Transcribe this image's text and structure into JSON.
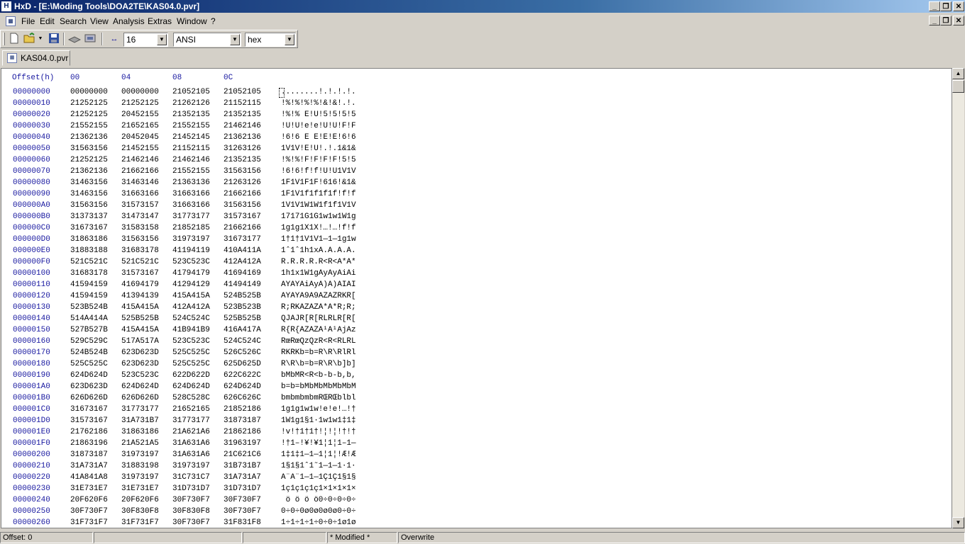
{
  "window": {
    "title": "HxD - [E:\\Moding Tools\\DOA2TE\\KAS04.0.pvr]"
  },
  "menu": [
    "File",
    "Edit",
    "Search",
    "View",
    "Analysis",
    "Extras",
    "Window",
    "?"
  ],
  "toolbar": {
    "bytes_per_row": "16",
    "charset": "ANSI",
    "offset_base": "hex"
  },
  "tabs": [
    {
      "label": "KAS04.0.pvr"
    }
  ],
  "hexview": {
    "header": {
      "offset": "Offset(h)",
      "cols": [
        "00",
        "04",
        "08",
        "0C"
      ]
    },
    "rows": [
      {
        "offset": "00000000",
        "hex": [
          "00000000",
          "00000000",
          "21052105",
          "21052105"
        ],
        "text": "........!.!.!.!."
      },
      {
        "offset": "00000010",
        "hex": [
          "21252125",
          "21252125",
          "21262126",
          "21152115"
        ],
        "text": "!%!%!%!%!&!&!.!."
      },
      {
        "offset": "00000020",
        "hex": [
          "21252125",
          "20452155",
          "21352135",
          "21352135"
        ],
        "text": "!%!% E!U!5!5!5!5"
      },
      {
        "offset": "00000030",
        "hex": [
          "21552155",
          "21652165",
          "21552155",
          "21462146"
        ],
        "text": "!U!U!e!e!U!U!F!F"
      },
      {
        "offset": "00000040",
        "hex": [
          "21362136",
          "20452045",
          "21452145",
          "21362136"
        ],
        "text": "!6!6 E E!E!E!6!6"
      },
      {
        "offset": "00000050",
        "hex": [
          "31563156",
          "21452155",
          "21152115",
          "31263126"
        ],
        "text": "1V1V!E!U!.!.1&1&"
      },
      {
        "offset": "00000060",
        "hex": [
          "21252125",
          "21462146",
          "21462146",
          "21352135"
        ],
        "text": "!%!%!F!F!F!F!5!5"
      },
      {
        "offset": "00000070",
        "hex": [
          "21362136",
          "21662166",
          "21552155",
          "31563156"
        ],
        "text": "!6!6!f!f!U!U1V1V"
      },
      {
        "offset": "00000080",
        "hex": [
          "31463156",
          "31463146",
          "21363136",
          "21263126"
        ],
        "text": "1F1V1F1F!616!&1&"
      },
      {
        "offset": "00000090",
        "hex": [
          "31463156",
          "31663166",
          "31663166",
          "21662166"
        ],
        "text": "1F1V1f1f1f1f!f!f"
      },
      {
        "offset": "000000A0",
        "hex": [
          "31563156",
          "31573157",
          "31663166",
          "31563156"
        ],
        "text": "1V1V1W1W1f1f1V1V"
      },
      {
        "offset": "000000B0",
        "hex": [
          "31373137",
          "31473147",
          "31773177",
          "31573167"
        ],
        "text": "17171G1G1w1w1W1g"
      },
      {
        "offset": "000000C0",
        "hex": [
          "31673167",
          "31583158",
          "21852185",
          "21662166"
        ],
        "text": "1g1g1X1X!…!…!f!f"
      },
      {
        "offset": "000000D0",
        "hex": [
          "31863186",
          "31563156",
          "31973197",
          "31673177"
        ],
        "text": "1†1†1V1V1—1—1g1w"
      },
      {
        "offset": "000000E0",
        "hex": [
          "31883188",
          "31683178",
          "41194119",
          "410A411A"
        ],
        "text": "1ˆ1ˆ1h1xA.A.A.A."
      },
      {
        "offset": "000000F0",
        "hex": [
          "521C521C",
          "521C521C",
          "523C523C",
          "412A412A"
        ],
        "text": "R.R.R.R.R<R<A*A*"
      },
      {
        "offset": "00000100",
        "hex": [
          "31683178",
          "31573167",
          "41794179",
          "41694169"
        ],
        "text": "1h1x1W1gAyAyAiAi"
      },
      {
        "offset": "00000110",
        "hex": [
          "41594159",
          "41694179",
          "41294129",
          "41494149"
        ],
        "text": "AYAYAiAyA)A)AIAI"
      },
      {
        "offset": "00000120",
        "hex": [
          "41594159",
          "41394139",
          "415A415A",
          "524B525B"
        ],
        "text": "AYAYA9A9AZAZRKR["
      },
      {
        "offset": "00000130",
        "hex": [
          "523B524B",
          "415A415A",
          "412A412A",
          "523B523B"
        ],
        "text": "R;RKAZAZA*A*R;R;"
      },
      {
        "offset": "00000140",
        "hex": [
          "514A414A",
          "525B525B",
          "524C524C",
          "525B525B"
        ],
        "text": "QJAJR[R[RLRLR[R["
      },
      {
        "offset": "00000150",
        "hex": [
          "527B527B",
          "415A415A",
          "41B941B9",
          "416A417A"
        ],
        "text": "R{R{AZAZA¹A¹AjAz"
      },
      {
        "offset": "00000160",
        "hex": [
          "529C529C",
          "517A517A",
          "523C523C",
          "524C524C"
        ],
        "text": "RœRœQzQzR<R<RLRL"
      },
      {
        "offset": "00000170",
        "hex": [
          "524B524B",
          "623D623D",
          "525C525C",
          "526C526C"
        ],
        "text": "RKRKb=b=R\\R\\RlRl"
      },
      {
        "offset": "00000180",
        "hex": [
          "525C525C",
          "623D623D",
          "525C525C",
          "625D625D"
        ],
        "text": "R\\R\\b=b=R\\R\\b]b]"
      },
      {
        "offset": "00000190",
        "hex": [
          "624D624D",
          "523C523C",
          "622D622D",
          "622C622C"
        ],
        "text": "bMbMR<R<b-b-b,b,"
      },
      {
        "offset": "000001A0",
        "hex": [
          "623D623D",
          "624D624D",
          "624D624D",
          "624D624D"
        ],
        "text": "b=b=bMbMbMbMbMbM"
      },
      {
        "offset": "000001B0",
        "hex": [
          "626D626D",
          "626D626D",
          "528C528C",
          "626C626C"
        ],
        "text": "bmbmbmbmRŒRŒblbl"
      },
      {
        "offset": "000001C0",
        "hex": [
          "31673167",
          "31773177",
          "21652165",
          "21852186"
        ],
        "text": "1g1g1w1w!e!e!…!†"
      },
      {
        "offset": "000001D0",
        "hex": [
          "31573167",
          "31A731B7",
          "31773177",
          "31873187"
        ],
        "text": "1W1g1§1·1w1w1‡1‡"
      },
      {
        "offset": "000001E0",
        "hex": [
          "21762186",
          "31863186",
          "21A621A6",
          "21862186"
        ],
        "text": "!v!†1†1†!¦!¦!†!†"
      },
      {
        "offset": "000001F0",
        "hex": [
          "21863196",
          "21A521A5",
          "31A631A6",
          "31963197"
        ],
        "text": "!†1–!¥!¥1¦1¦1–1—"
      },
      {
        "offset": "00000200",
        "hex": [
          "31873187",
          "31973197",
          "31A631A6",
          "21C621C6"
        ],
        "text": "1‡1‡1—1—1¦1¦!Æ!Æ"
      },
      {
        "offset": "00000210",
        "hex": [
          "31A731A7",
          "31883198",
          "31973197",
          "31B731B7"
        ],
        "text": "1§1§1ˆ1˜1—1—1·1·"
      },
      {
        "offset": "00000220",
        "hex": [
          "41A841A8",
          "31973197",
          "31C731C7",
          "31A731A7"
        ],
        "text": "A¨A¨1—1—1Ç1Ç1§1§"
      },
      {
        "offset": "00000230",
        "hex": [
          "31E731E7",
          "31E731E7",
          "31D731D7",
          "31D731D7"
        ],
        "text": "1ç1ç1ç1ç1×1×1×1×"
      },
      {
        "offset": "00000240",
        "hex": [
          "20F620F6",
          "20F620F6",
          "30F730F7",
          "30F730F7"
        ],
        "text": " ö ö ö ö0÷0÷0÷0÷"
      },
      {
        "offset": "00000250",
        "hex": [
          "30F730F7",
          "30F830F8",
          "30F830F8",
          "30F730F7"
        ],
        "text": "0÷0÷0ø0ø0ø0ø0÷0÷"
      },
      {
        "offset": "00000260",
        "hex": [
          "31F731F7",
          "31F731F7",
          "30F730F7",
          "31F831F8"
        ],
        "text": "1÷1÷1÷1÷0÷0÷1ø1ø"
      }
    ]
  },
  "status": {
    "offset": "Offset: 0",
    "modified": "* Modified *",
    "mode": "Overwrite"
  }
}
